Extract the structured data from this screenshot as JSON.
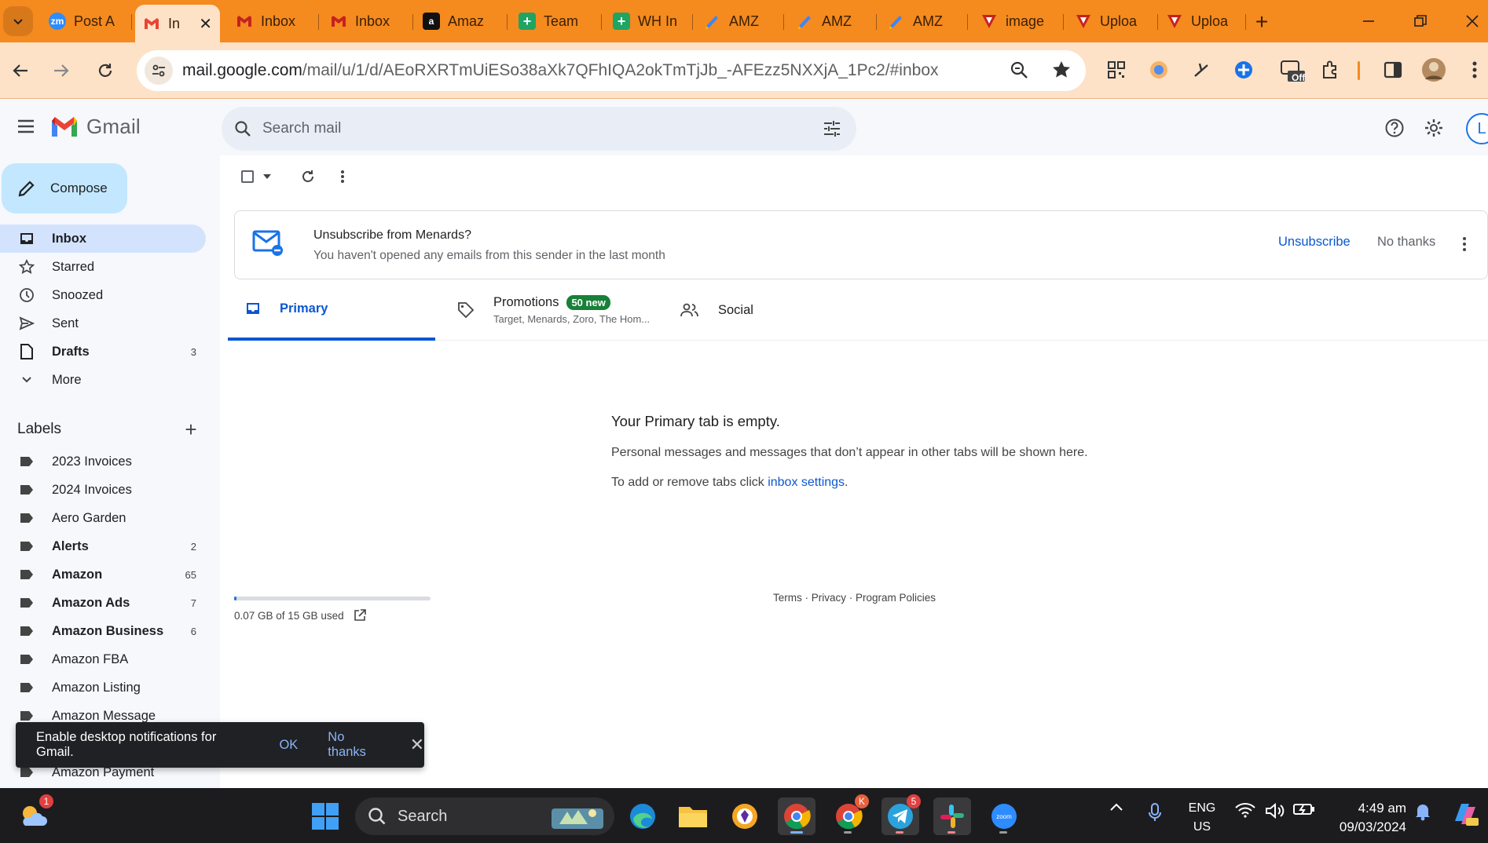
{
  "browser": {
    "tabs": [
      {
        "title": "Post A",
        "favicon": "zoom-icon"
      },
      {
        "title": "In",
        "favicon": "gmail-icon",
        "active": true
      },
      {
        "title": "Inbox",
        "favicon": "gmail-icon"
      },
      {
        "title": "Inbox",
        "favicon": "gmail-icon"
      },
      {
        "title": "Amaz",
        "favicon": "amazon-icon"
      },
      {
        "title": "Team",
        "favicon": "sheets-icon"
      },
      {
        "title": "WH In",
        "favicon": "sheets-icon"
      },
      {
        "title": "AMZ",
        "favicon": "pencil-app-icon"
      },
      {
        "title": "AMZ",
        "favicon": "pencil-app-icon"
      },
      {
        "title": "AMZ",
        "favicon": "pencil-app-icon"
      },
      {
        "title": "image",
        "favicon": "uploader-icon"
      },
      {
        "title": "Uploa",
        "favicon": "uploader-icon"
      },
      {
        "title": "Uploa",
        "favicon": "uploader-icon"
      }
    ],
    "url_host": "mail.google.com",
    "url_path": "/mail/u/1/d/AEoRXRTmUiESo38aXk7QFhIQA2okTmTjJb_-AFEzz5NXXjA_1Pc2/#inbox",
    "extension_off_label": "Off",
    "colors": {
      "chrome_frame": "#f58a1f",
      "toolbar": "#fde2c8"
    }
  },
  "gmail": {
    "brand": "Gmail",
    "search_placeholder": "Search mail",
    "avatar_letter": "L",
    "compose_label": "Compose",
    "nav": [
      {
        "label": "Inbox",
        "icon": "inbox-icon",
        "count": "",
        "active": true
      },
      {
        "label": "Starred",
        "icon": "star-icon",
        "count": ""
      },
      {
        "label": "Snoozed",
        "icon": "clock-icon",
        "count": ""
      },
      {
        "label": "Sent",
        "icon": "send-icon",
        "count": ""
      },
      {
        "label": "Drafts",
        "icon": "draft-icon",
        "count": "3",
        "bold": true
      },
      {
        "label": "More",
        "icon": "chevron-down-icon",
        "count": ""
      }
    ],
    "labels_heading": "Labels",
    "labels": [
      {
        "label": "2023 Invoices",
        "count": ""
      },
      {
        "label": "2024 Invoices",
        "count": ""
      },
      {
        "label": "Aero Garden",
        "count": ""
      },
      {
        "label": "Alerts",
        "count": "2",
        "bold": true
      },
      {
        "label": "Amazon",
        "count": "65",
        "bold": true
      },
      {
        "label": "Amazon Ads",
        "count": "7",
        "bold": true
      },
      {
        "label": "Amazon Business",
        "count": "6",
        "bold": true
      },
      {
        "label": "Amazon FBA",
        "count": ""
      },
      {
        "label": "Amazon Listing",
        "count": ""
      },
      {
        "label": "Amazon Message",
        "count": ""
      },
      {
        "label": "",
        "count": ""
      },
      {
        "label": "Amazon Payment",
        "count": ""
      }
    ],
    "unsubscribe": {
      "title": "Unsubscribe from Menards?",
      "subtitle": "You haven't opened any emails from this sender in the last month",
      "yes_label": "Unsubscribe",
      "no_label": "No thanks"
    },
    "tabs": {
      "primary": "Primary",
      "promotions": "Promotions",
      "promotions_badge": "50 new",
      "promotions_senders": "Target, Menards, Zoro, The Hom...",
      "social": "Social"
    },
    "empty_state": {
      "title": "Your Primary tab is empty.",
      "line1": "Personal messages and messages that don’t appear in other tabs will be shown here.",
      "line2_prefix": "To add or remove tabs click ",
      "line2_link": "inbox settings",
      "line2_suffix": "."
    },
    "storage": {
      "text": "0.07 GB of 15 GB used",
      "used_fraction": 0.005
    },
    "footer": {
      "terms": "Terms",
      "privacy": "Privacy",
      "policies": "Program Policies",
      "sep": " · "
    },
    "snackbar": {
      "text": "Enable desktop notifications for Gmail.",
      "ok": "OK",
      "no": "No thanks"
    },
    "colors": {
      "accent": "#0b57d0",
      "active_nav": "#d3e3fd",
      "compose": "#c2e7ff",
      "badge": "#188038"
    }
  },
  "taskbar": {
    "search_label": "Search",
    "weather_badge": "1",
    "telegram_badge": "5",
    "chrome_profile_badge": "K",
    "lang_top": "ENG",
    "lang_bottom": "US",
    "time": "4:49 am",
    "date": "09/03/2024"
  }
}
